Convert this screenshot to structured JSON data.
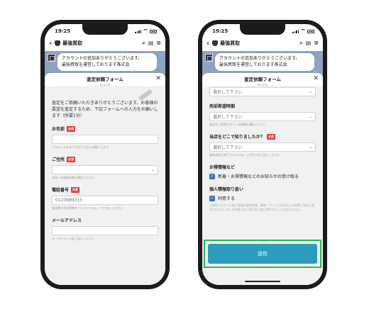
{
  "status_time": "19:25",
  "chat": {
    "title": "最強買取",
    "bubble_lines": [
      "アカウントの追加ありがとうございます。",
      "最強買取を運営しております株式会"
    ]
  },
  "form": {
    "title": "査定依頼フォーム",
    "subtitle": "by Liny",
    "close": "✕",
    "intro": "査定をご依頼いただきありがとうございます。お客様の要望を査定するため、下記フォームへの入力をお願いします（所要1分）",
    "required": "必須",
    "optional": "任意",
    "name_label": "お名前",
    "name_hint": "フルネームをひらがなでご記入お願いします",
    "address_label": "ご住所",
    "address_hint": "お住いの都道府県を選択ください",
    "phone_label": "電話番号",
    "phone_placeholder": "0120889315",
    "phone_hint": "電話番号を半角数字（ハイフンなし）でご記入ください",
    "email_label": "メールアドレス",
    "email_hint": "メールアドレスをご記入ください",
    "select_placeholder": "選択して下さい",
    "sale_label": "売却希望時期",
    "sale_hint": "査定をご希望されている時期を選択ください",
    "source_label": "当店をどこで知りましたか？",
    "source_hint": "媒体決定を完了させるため、いずれかをご記入ください",
    "deals_label": "お得情報など",
    "deals_check": "新着・お得情報などのお知らせの受け取る",
    "privacy_label": "個人情報取り扱い",
    "privacy_check": "同意する",
    "privacy_notice": "ご提供いただいた個人情報は査定依頼・買取・サービス案内および各種ご案内に使用されます。本人の同意がない限り第三者に提供することはありません。",
    "submit": "送信"
  },
  "colors": {
    "submit": "#2c9dbd",
    "highlight": "#2db35a",
    "required": "#e03a3a",
    "check": "#3f72c8"
  }
}
